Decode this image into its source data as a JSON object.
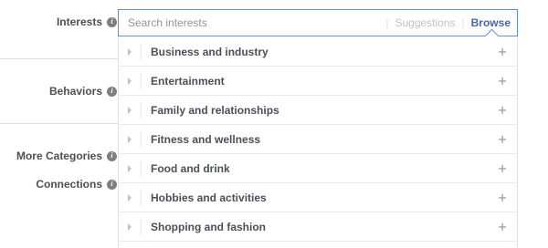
{
  "labels": {
    "interests": "Interests",
    "behaviors": "Behaviors",
    "more_categories": "More Categories",
    "connections": "Connections"
  },
  "icons": {
    "info": "info-icon",
    "expand": "triangle-right-icon",
    "add": "plus-icon"
  },
  "search": {
    "placeholder": "Search interests",
    "suggestions_label": "Suggestions",
    "browse_label": "Browse",
    "separator": "|"
  },
  "categories": [
    {
      "label": "Business and industry",
      "add": "+"
    },
    {
      "label": "Entertainment",
      "add": "+"
    },
    {
      "label": "Family and relationships",
      "add": "+"
    },
    {
      "label": "Fitness and wellness",
      "add": "+"
    },
    {
      "label": "Food and drink",
      "add": "+"
    },
    {
      "label": "Hobbies and activities",
      "add": "+"
    },
    {
      "label": "Shopping and fashion",
      "add": "+"
    }
  ],
  "colors": {
    "accent": "#4267b2",
    "focus_border": "#5b90e5",
    "text": "#4b4f56",
    "muted": "#90949c"
  }
}
